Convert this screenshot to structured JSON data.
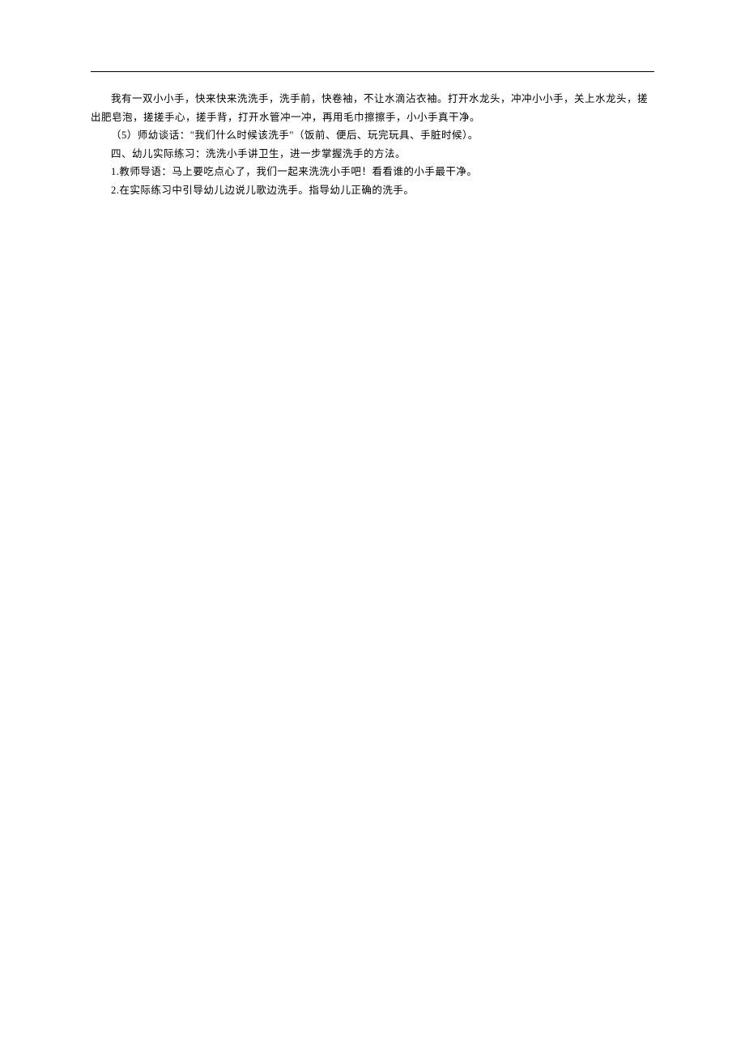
{
  "document": {
    "paragraphs": [
      "我有一双小小手，快来快来洗洗手，洗手前，快卷袖，不让水滴沾衣袖。打开水龙头，冲冲小小手，关上水龙头，搓出肥皂泡，搓搓手心，搓手背，打开水管冲一冲，再用毛巾擦擦手，小小手真干净。",
      "（5）师幼谈话：\"我们什么时候该洗手\"（饭前、便后、玩完玩具、手脏时候）。",
      "四、幼儿实际练习：洗洗小手讲卫生，进一步掌握洗手的方法。",
      "1.教师导语：马上要吃点心了，我们一起来洗洗小手吧！看看谁的小手最干净。",
      "2.在实际练习中引导幼儿边说儿歌边洗手。指导幼儿正确的洗手。"
    ]
  }
}
